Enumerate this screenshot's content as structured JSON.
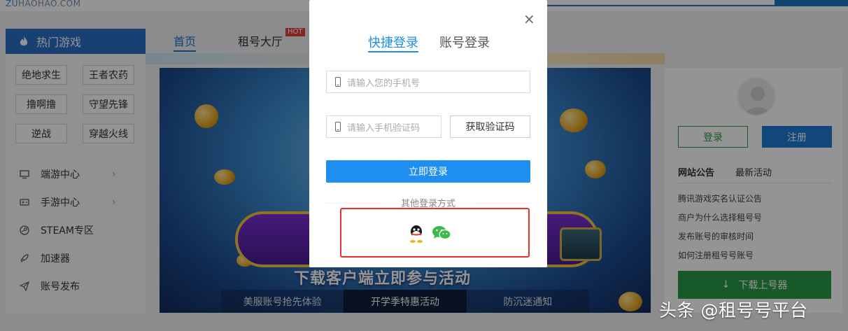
{
  "site": {
    "logo_prefix": "ZU",
    "logo_rest": "HAOHAO.COM"
  },
  "sidebar": {
    "title": "热门游戏",
    "games": [
      "绝地求生",
      "王者农药",
      "撸啊撸",
      "守望先锋",
      "逆战",
      "穿越火线"
    ],
    "items": [
      {
        "label": "端游中心",
        "icon": "monitor-icon",
        "arrow": "›"
      },
      {
        "label": "手游中心",
        "icon": "gamepad-icon",
        "arrow": "›"
      },
      {
        "label": "STEAM专区",
        "icon": "steam-icon"
      },
      {
        "label": "加速器",
        "icon": "rocket-icon"
      },
      {
        "label": "账号发布",
        "icon": "send-icon"
      }
    ]
  },
  "main_tabs": [
    {
      "label": "首页"
    },
    {
      "label": "租号大厅",
      "badge": "HOT"
    }
  ],
  "banner": {
    "subtitle": "下载客户端立即参与活动",
    "tabs": [
      "美服账号抢先体验",
      "开学季特惠活动",
      "防沉迷通知"
    ]
  },
  "right_panel": {
    "login_label": "登录",
    "register_label": "注册",
    "tabs": [
      "网站公告",
      "最新活动"
    ],
    "announcements": [
      "腾讯游戏实名认证公告",
      "商户为什么选择租号号",
      "发布账号的审核时间",
      "如何注册租号号账号"
    ],
    "download_label": "下载上号器"
  },
  "modal": {
    "tabs": [
      "快捷登录",
      "账号登录"
    ],
    "phone_placeholder": "请输入您的手机号",
    "code_placeholder": "请输入手机验证码",
    "get_code_label": "获取验证码",
    "submit_label": "立即登录",
    "other_label": "其他登录方式",
    "close_glyph": "×",
    "social": [
      "qq-icon",
      "wechat-icon"
    ],
    "highlight_color": "#e5322d"
  },
  "watermark": "头条 @租号号平台",
  "colors": {
    "primary": "#1e8ef0",
    "brand_blue": "#2c6fc4",
    "green": "#2a9a48"
  }
}
